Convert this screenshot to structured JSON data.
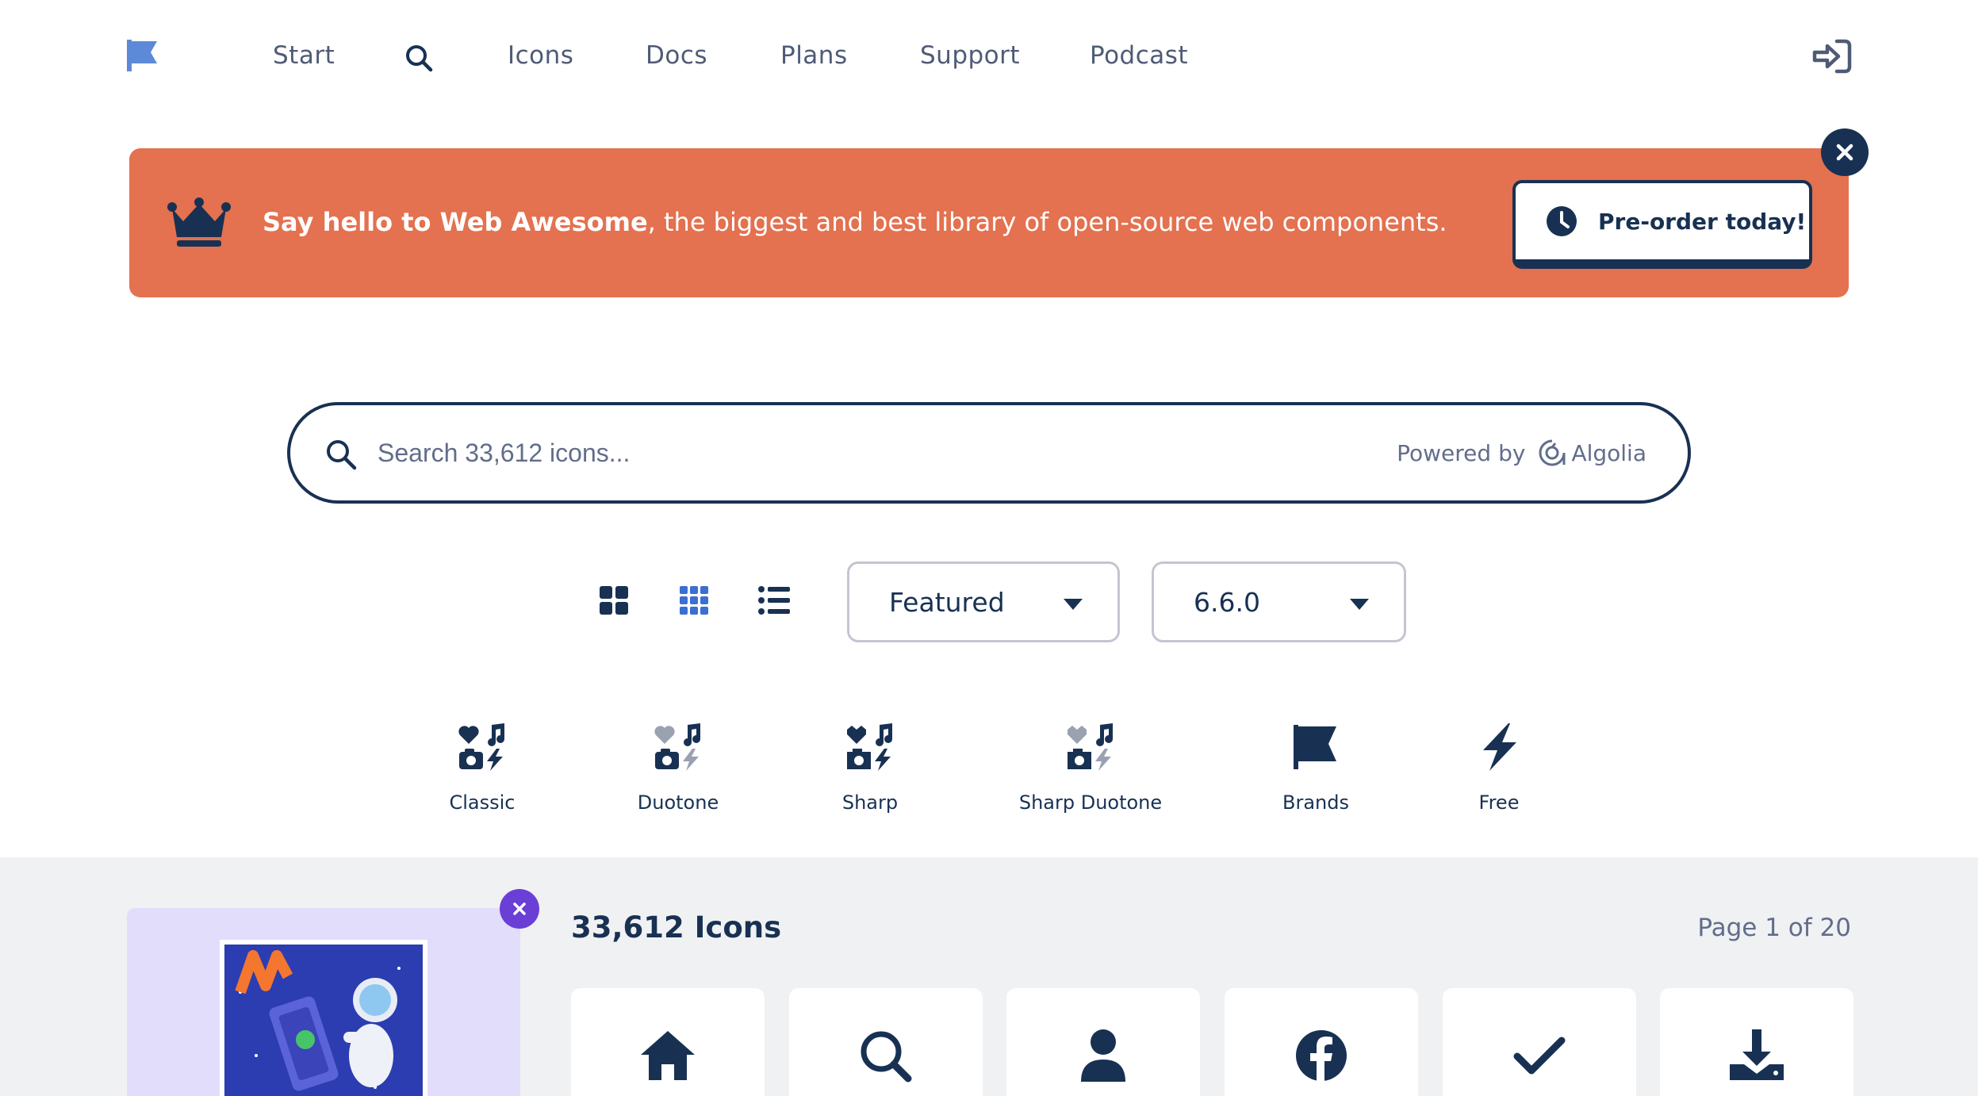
{
  "nav": {
    "items": [
      "Start",
      "Icons",
      "Docs",
      "Plans",
      "Support",
      "Podcast"
    ]
  },
  "banner": {
    "bold": "Say hello to Web Awesome",
    "text": ", the biggest and best library of open-source web components.",
    "cta": "Pre-order today!"
  },
  "search": {
    "placeholder": "Search 33,612 icons...",
    "powered_by": "Powered by",
    "provider": "Algolia"
  },
  "controls": {
    "sort": "Featured",
    "version": "6.6.0"
  },
  "families": [
    "Classic",
    "Duotone",
    "Sharp",
    "Sharp Duotone",
    "Brands",
    "Free"
  ],
  "results": {
    "count": "33,612 Icons",
    "page": "Page 1 of 20",
    "icons": [
      "house-icon",
      "magnifying-glass-icon",
      "user-icon",
      "facebook-icon",
      "check-icon",
      "download-icon"
    ]
  },
  "colors": {
    "navy": "#183153",
    "banner": "#e4714f",
    "accent_blue": "#3b6fd1",
    "ad_bg": "#e2ddfb",
    "ad_close": "#6a3fd6"
  }
}
